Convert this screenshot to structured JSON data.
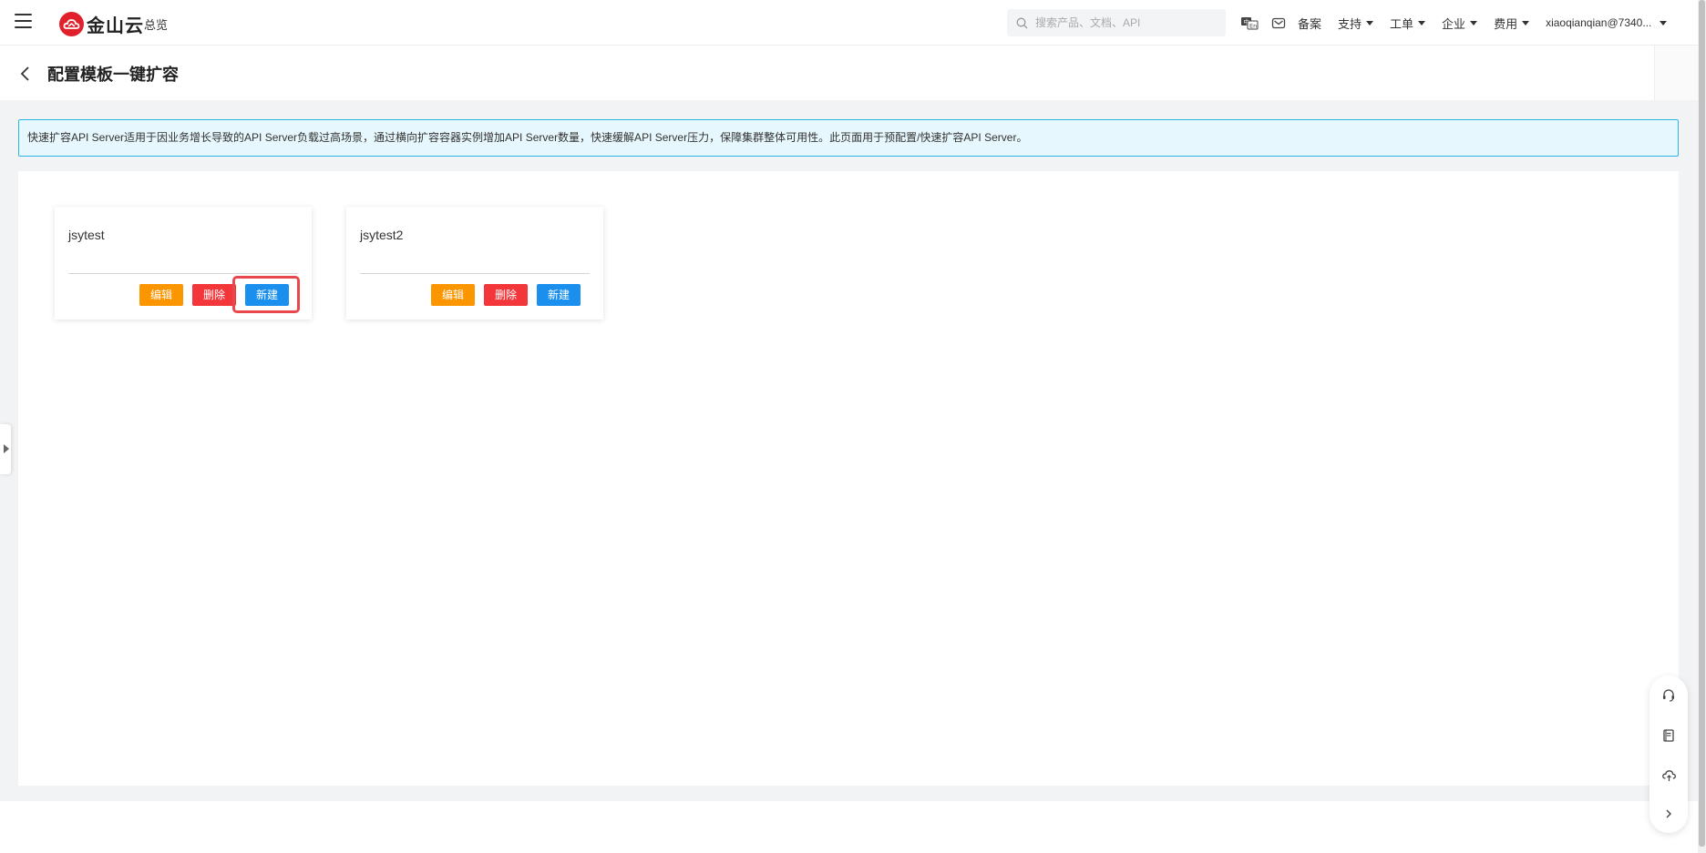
{
  "topbar": {
    "brand": "金山云",
    "overview": "总览",
    "search_placeholder": "搜索产品、文档、API",
    "nav": {
      "beian": "备案",
      "support": "支持",
      "ticket": "工单",
      "enterprise": "企业",
      "billing": "费用",
      "account": "xiaoqianqian@7340..."
    },
    "icons": [
      "menu-icon",
      "search-icon",
      "language-icon",
      "mail-icon"
    ]
  },
  "header": {
    "title": "配置模板一键扩容"
  },
  "notice": {
    "text": "快速扩容API Server适用于因业务增长导致的API Server负载过高场景，通过横向扩容容器实例增加API Server数量，快速缓解API Server压力，保障集群整体可用性。此页面用于预配置/快速扩容API Server。"
  },
  "cards": [
    {
      "name": "jsytest",
      "edit": "编辑",
      "delete": "删除",
      "new": "新建"
    },
    {
      "name": "jsytest2",
      "edit": "编辑",
      "delete": "删除",
      "new": "新建"
    }
  ],
  "colors": {
    "edit": "#fb9500",
    "delete": "#f2363a",
    "new": "#1a8fee",
    "brand": "#e0202b",
    "highlight": "#e8484c"
  },
  "float_toolbar": [
    "headset-icon",
    "book-icon",
    "cloud-icon",
    "chevron-right-icon"
  ]
}
